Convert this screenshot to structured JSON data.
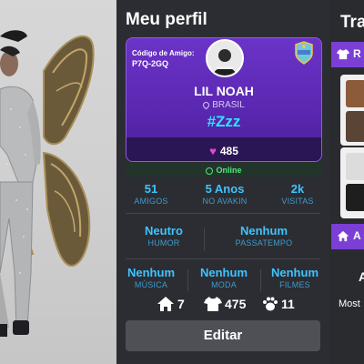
{
  "profile": {
    "title": "Meu perfil",
    "friend_code_label": "Código de Amigo:",
    "friend_code": "P7Q-2GQ",
    "username": "LIL NOAH",
    "country": "BRASIL",
    "status_tag": "#Zzz",
    "hearts": "485",
    "online_label": "Online"
  },
  "stats_top": [
    {
      "value": "51",
      "label": "AMIGOS"
    },
    {
      "value": "5 Anos",
      "label": "NO AVAKIN"
    },
    {
      "value": "2k",
      "label": "VISITAS"
    }
  ],
  "stats_mid": [
    {
      "value": "Neutro",
      "label": "HUMOR"
    },
    {
      "value": "Nenhum",
      "label": "PASSATEMPO"
    }
  ],
  "stats_bottom": [
    {
      "value": "Nenhum",
      "label": "MÚSICA"
    },
    {
      "value": "Nenhum",
      "label": "MODA"
    },
    {
      "value": "Nenhum",
      "label": "FILMES"
    }
  ],
  "counts": {
    "homes": "7",
    "outfits": "475",
    "pets": "11"
  },
  "edit_label": "Editar",
  "right_panel": {
    "title": "Tra",
    "tab1": "R",
    "tab2": "A",
    "a_text": "A",
    "most_text": "Most"
  },
  "colors": {
    "accent_purple": "#6b33c8",
    "stat_blue": "#3fc3ff",
    "online_green": "#4fe87a",
    "heart_pink": "#d94bd0"
  }
}
